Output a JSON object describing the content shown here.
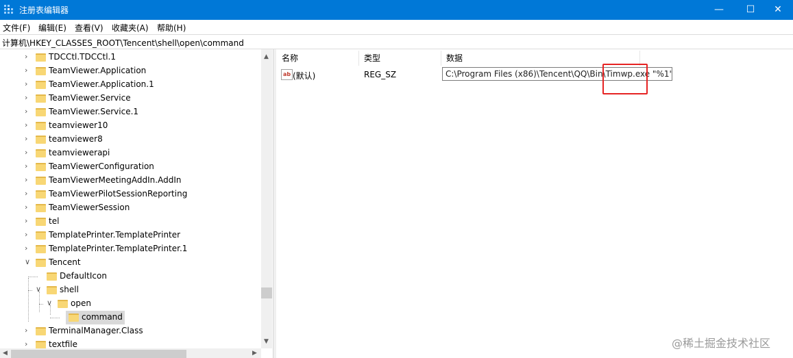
{
  "window": {
    "title": "注册表编辑器",
    "controls": {
      "minimize": "—",
      "maximize": "☐",
      "close": "✕"
    }
  },
  "menu": [
    "文件(F)",
    "编辑(E)",
    "查看(V)",
    "收藏夹(A)",
    "帮助(H)"
  ],
  "address": "计算机\\HKEY_CLASSES_ROOT\\Tencent\\shell\\open\\command",
  "tree": {
    "nodes": [
      {
        "label": "TDCCtl.TDCCtl.1",
        "expander": "collapsed",
        "depth": 0
      },
      {
        "label": "TeamViewer.Application",
        "expander": "collapsed",
        "depth": 0
      },
      {
        "label": "TeamViewer.Application.1",
        "expander": "collapsed",
        "depth": 0
      },
      {
        "label": "TeamViewer.Service",
        "expander": "collapsed",
        "depth": 0
      },
      {
        "label": "TeamViewer.Service.1",
        "expander": "collapsed",
        "depth": 0
      },
      {
        "label": "teamviewer10",
        "expander": "collapsed",
        "depth": 0
      },
      {
        "label": "teamviewer8",
        "expander": "collapsed",
        "depth": 0
      },
      {
        "label": "teamviewerapi",
        "expander": "collapsed",
        "depth": 0
      },
      {
        "label": "TeamViewerConfiguration",
        "expander": "collapsed",
        "depth": 0
      },
      {
        "label": "TeamViewerMeetingAddIn.AddIn",
        "expander": "collapsed",
        "depth": 0
      },
      {
        "label": "TeamViewerPilotSessionReporting",
        "expander": "collapsed",
        "depth": 0
      },
      {
        "label": "TeamViewerSession",
        "expander": "collapsed",
        "depth": 0
      },
      {
        "label": "tel",
        "expander": "collapsed",
        "depth": 0
      },
      {
        "label": "TemplatePrinter.TemplatePrinter",
        "expander": "collapsed",
        "depth": 0
      },
      {
        "label": "TemplatePrinter.TemplatePrinter.1",
        "expander": "collapsed",
        "depth": 0
      },
      {
        "label": "Tencent",
        "expander": "expanded",
        "depth": 0
      },
      {
        "label": "DefaultIcon",
        "expander": "none",
        "depth": 1
      },
      {
        "label": "shell",
        "expander": "expanded",
        "depth": 1
      },
      {
        "label": "open",
        "expander": "expanded",
        "depth": 2
      },
      {
        "label": "command",
        "expander": "none",
        "depth": 3,
        "selected": true
      },
      {
        "label": "TerminalManager.Class",
        "expander": "collapsed",
        "depth": 0
      },
      {
        "label": "textfile",
        "expander": "collapsed",
        "depth": 0
      }
    ]
  },
  "values": {
    "headers": {
      "name": "名称",
      "type": "类型",
      "data": "数据"
    },
    "rows": [
      {
        "icon": "ab",
        "name": "(默认)",
        "type": "REG_SZ",
        "data": "C:\\Program Files (x86)\\Tencent\\QQ\\Bin\\Timwp.exe \"%1\""
      }
    ]
  },
  "watermark": "@稀土掘金技术社区",
  "colors": {
    "titlebar": "#0078d7",
    "folder": "#f8d775",
    "highlight": "#e62222"
  }
}
